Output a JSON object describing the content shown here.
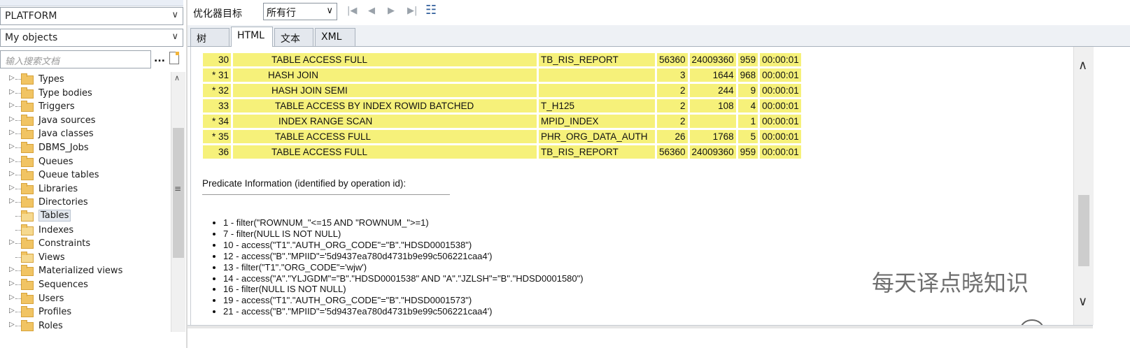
{
  "left_panel": {
    "user_combo": "PLATFORM",
    "filter_combo": "My objects",
    "search_placeholder": "输入搜索文档",
    "dots": "...",
    "tree": [
      {
        "label": "Types",
        "expandable": true
      },
      {
        "label": "Type bodies",
        "expandable": true
      },
      {
        "label": "Triggers",
        "expandable": true
      },
      {
        "label": "Java sources",
        "expandable": true
      },
      {
        "label": "Java classes",
        "expandable": true
      },
      {
        "label": "DBMS_Jobs",
        "expandable": true
      },
      {
        "label": "Queues",
        "expandable": true
      },
      {
        "label": "Queue tables",
        "expandable": true
      },
      {
        "label": "Libraries",
        "expandable": true
      },
      {
        "label": "Directories",
        "expandable": true
      },
      {
        "label": "Tables",
        "expandable": false,
        "selected": true
      },
      {
        "label": "Indexes",
        "expandable": false
      },
      {
        "label": "Constraints",
        "expandable": true
      },
      {
        "label": "Views",
        "expandable": false
      },
      {
        "label": "Materialized views",
        "expandable": true
      },
      {
        "label": "Sequences",
        "expandable": true
      },
      {
        "label": "Users",
        "expandable": true
      },
      {
        "label": "Profiles",
        "expandable": true
      },
      {
        "label": "Roles",
        "expandable": true
      }
    ]
  },
  "toolbar": {
    "optimizer_label": "优化器目标",
    "optimizer_value": "所有行"
  },
  "tabs": [
    {
      "label": "树",
      "active": false
    },
    {
      "label": "HTML",
      "active": true
    },
    {
      "label": "文本",
      "active": false
    },
    {
      "label": "XML",
      "active": false
    }
  ],
  "plan_rows": [
    {
      "id": "30",
      "op": "TABLE ACCESS FULL",
      "indent": 3,
      "obj": "TB_RIS_REPORT",
      "rows": "56360",
      "bytes": "24009360",
      "cost": "959",
      "time": "00:00:01"
    },
    {
      "id": "* 31",
      "op": "HASH JOIN",
      "indent": 2,
      "obj": "",
      "rows": "3",
      "bytes": "1644",
      "cost": "968",
      "time": "00:00:01"
    },
    {
      "id": "* 32",
      "op": "HASH JOIN SEMI",
      "indent": 3,
      "obj": "",
      "rows": "2",
      "bytes": "244",
      "cost": "9",
      "time": "00:00:01"
    },
    {
      "id": "33",
      "op": "TABLE ACCESS BY INDEX ROWID BATCHED",
      "indent": 4,
      "obj": "T_H125",
      "rows": "2",
      "bytes": "108",
      "cost": "4",
      "time": "00:00:01"
    },
    {
      "id": "* 34",
      "op": "INDEX RANGE SCAN",
      "indent": 5,
      "obj": "MPID_INDEX",
      "rows": "2",
      "bytes": "",
      "cost": "1",
      "time": "00:00:01"
    },
    {
      "id": "* 35",
      "op": "TABLE ACCESS FULL",
      "indent": 4,
      "obj": "PHR_ORG_DATA_AUTH",
      "rows": "26",
      "bytes": "1768",
      "cost": "5",
      "time": "00:00:01"
    },
    {
      "id": "36",
      "op": "TABLE ACCESS FULL",
      "indent": 3,
      "obj": "TB_RIS_REPORT",
      "rows": "56360",
      "bytes": "24009360",
      "cost": "959",
      "time": "00:00:01"
    }
  ],
  "predicate_heading": "Predicate Information (identified by operation id):",
  "predicates": [
    "1 - filter(\"ROWNUM_\"<=15 AND \"ROWNUM_\">=1)",
    "7 - filter(NULL IS NOT NULL)",
    "10 - access(\"T1\".\"AUTH_ORG_CODE\"=\"B\".\"HDSD0001538\")",
    "12 - access(\"B\".\"MPIID\"='5d9437ea780d4731b9e99c506221caa4')",
    "13 - filter(\"T1\".\"ORG_CODE\"='wjw')",
    "14 - access(\"A\".\"YLJGDM\"=\"B\".\"HDSD0001538\" AND \"A\".\"JZLSH\"=\"B\".\"HDSD0001580\")",
    "16 - filter(NULL IS NOT NULL)",
    "19 - access(\"T1\".\"AUTH_ORG_CODE\"=\"B\".\"HDSD0001573\")",
    "21 - access(\"B\".\"MPIID\"='5d9437ea780d4731b9e99c506221caa4')"
  ],
  "watermark": "每天译点晓知识"
}
